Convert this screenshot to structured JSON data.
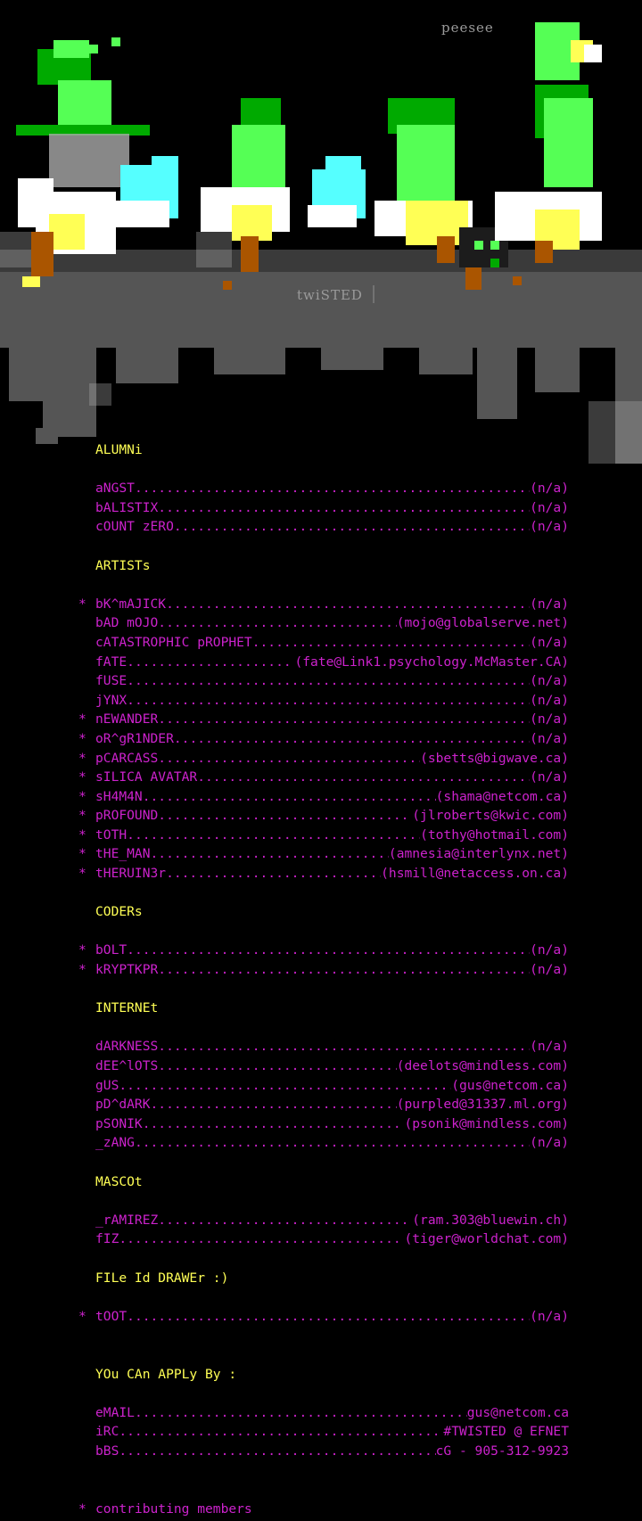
{
  "art": {
    "artist_tag": "peesee",
    "group_tag": "twiSTED",
    "colors": {
      "green_bright": "#55ff55",
      "green": "#00aa00",
      "cyan": "#55ffff",
      "white": "#ffffff",
      "yellow": "#ffff55",
      "brown": "#aa5500",
      "gray": "#555555",
      "light_gray": "#aaaaaa"
    }
  },
  "sections": [
    {
      "heading": "ALUMNi",
      "entries": [
        {
          "star": false,
          "name": "aNGST",
          "contact": "(n/a)"
        },
        {
          "star": false,
          "name": "bALISTIX",
          "contact": "(n/a)"
        },
        {
          "star": false,
          "name": "cOUNT zERO",
          "contact": "(n/a)"
        }
      ]
    },
    {
      "heading": "ARTISTs",
      "entries": [
        {
          "star": true,
          "name": "bK^mAJICK",
          "contact": "(n/a)"
        },
        {
          "star": false,
          "name": "bAD mOJO",
          "contact": "(mojo@globalserve.net)"
        },
        {
          "star": false,
          "name": "cATASTROPHIC pROPHET",
          "contact": "(n/a)"
        },
        {
          "star": false,
          "name": "fATE",
          "contact": "(fate@Link1.psychology.McMaster.CA)"
        },
        {
          "star": false,
          "name": "fUSE",
          "contact": "(n/a)"
        },
        {
          "star": false,
          "name": "jYNX",
          "contact": "(n/a)"
        },
        {
          "star": true,
          "name": "nEWANDER",
          "contact": "(n/a)"
        },
        {
          "star": true,
          "name": "oR^gR1NDER",
          "contact": "(n/a)"
        },
        {
          "star": true,
          "name": "pCARCASS",
          "contact": "(sbetts@bigwave.ca)"
        },
        {
          "star": true,
          "name": "sILICA AVATAR",
          "contact": "(n/a)"
        },
        {
          "star": true,
          "name": "sH4M4N",
          "contact": "(shama@netcom.ca)"
        },
        {
          "star": true,
          "name": "pROFOUND",
          "contact": "(jlroberts@kwic.com)"
        },
        {
          "star": true,
          "name": "tOTH",
          "contact": "(tothy@hotmail.com)"
        },
        {
          "star": true,
          "name": "tHE_MAN",
          "contact": "(amnesia@interlynx.net)"
        },
        {
          "star": true,
          "name": "tHERUIN3r",
          "contact": "(hsmill@netaccess.on.ca)"
        }
      ]
    },
    {
      "heading": "CODERs",
      "entries": [
        {
          "star": true,
          "name": "bOLT",
          "contact": "(n/a)"
        },
        {
          "star": true,
          "name": "kRYPTKPR",
          "contact": "(n/a)"
        }
      ]
    },
    {
      "heading": "INTERNEt",
      "entries": [
        {
          "star": false,
          "name": "dARKNESS",
          "contact": "(n/a)"
        },
        {
          "star": false,
          "name": "dEE^lOTS",
          "contact": "(deelots@mindless.com)"
        },
        {
          "star": false,
          "name": "gUS",
          "contact": "(gus@netcom.ca)"
        },
        {
          "star": false,
          "name": "pD^dARK",
          "contact": "(purpled@31337.ml.org)"
        },
        {
          "star": false,
          "name": "pSONIK",
          "contact": "(psonik@mindless.com)"
        },
        {
          "star": false,
          "name": "_zANG",
          "contact": "(n/a)"
        }
      ]
    },
    {
      "heading": "MASCOt",
      "entries": [
        {
          "star": false,
          "name": "_rAMIREZ",
          "contact": "(ram.303@bluewin.ch)"
        },
        {
          "star": false,
          "name": "fIZ",
          "contact": "(tiger@worldchat.com)"
        }
      ]
    },
    {
      "heading": "FILe Id DRAWEr :)",
      "entries": [
        {
          "star": true,
          "name": "tOOT",
          "contact": "(n/a)"
        }
      ]
    }
  ],
  "apply": {
    "heading": "YOu CAn APPLy By :",
    "entries": [
      {
        "star": false,
        "name": "eMAIL",
        "contact": "gus@netcom.ca"
      },
      {
        "star": false,
        "name": "iRC",
        "contact": "#TWISTED @ EFNET"
      },
      {
        "star": false,
        "name": "bBS",
        "contact": "cG - 905-312-9923"
      }
    ]
  },
  "footer": {
    "star": "*",
    "note": "contributing members"
  }
}
